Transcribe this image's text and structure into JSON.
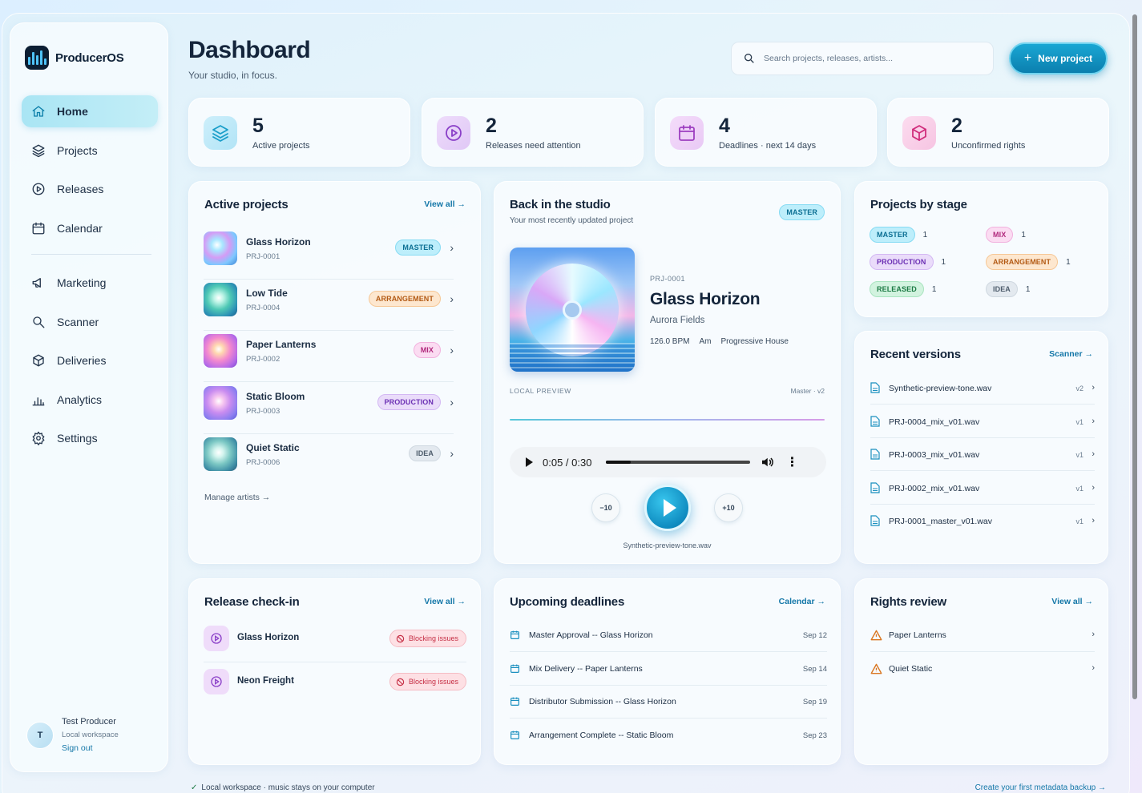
{
  "brand": {
    "name": "ProducerOS"
  },
  "nav": [
    {
      "label": "Home",
      "icon": "home-icon",
      "active": true
    },
    {
      "label": "Projects",
      "icon": "layers-icon"
    },
    {
      "label": "Releases",
      "icon": "play-circle-icon"
    },
    {
      "label": "Calendar",
      "icon": "calendar-icon"
    },
    {
      "label": "Marketing",
      "icon": "megaphone-icon"
    },
    {
      "label": "Scanner",
      "icon": "search-icon"
    },
    {
      "label": "Deliveries",
      "icon": "box-icon"
    },
    {
      "label": "Analytics",
      "icon": "bar-chart-icon"
    },
    {
      "label": "Settings",
      "icon": "gear-icon"
    }
  ],
  "user": {
    "initial": "T",
    "name": "Test Producer",
    "workspace": "Local workspace",
    "sign_out": "Sign out"
  },
  "header": {
    "title": "Dashboard",
    "subtitle": "Your studio, in focus.",
    "search_placeholder": "Search projects, releases, artists...",
    "new_button": "New project"
  },
  "stats": [
    {
      "value": "5",
      "label": "Active projects",
      "icon": "layers-icon",
      "color": "#1a9ec9"
    },
    {
      "value": "2",
      "label": "Releases need attention",
      "icon": "play-circle-icon",
      "color": "#8a3fc8"
    },
    {
      "value": "4",
      "label": "Deadlines · next 14 days",
      "icon": "calendar-icon",
      "color": "#9d3fc0"
    },
    {
      "value": "2",
      "label": "Unconfirmed rights",
      "icon": "cube-icon",
      "color": "#d02d7c"
    }
  ],
  "active_projects": {
    "title": "Active projects",
    "link": "View all →",
    "items": [
      {
        "name": "Glass Horizon",
        "id": "PRJ-0001",
        "stage": "MASTER"
      },
      {
        "name": "Low Tide",
        "id": "PRJ-0004",
        "stage": "ARRANGEMENT"
      },
      {
        "name": "Paper Lanterns",
        "id": "PRJ-0002",
        "stage": "MIX"
      },
      {
        "name": "Static Bloom",
        "id": "PRJ-0003",
        "stage": "PRODUCTION"
      },
      {
        "name": "Quiet Static",
        "id": "PRJ-0006",
        "stage": "IDEA"
      }
    ],
    "manage": "Manage artists →"
  },
  "studio": {
    "title": "Back in the studio",
    "subtitle": "Your most recently updated project",
    "stage": "MASTER",
    "project_id": "PRJ-0001",
    "project_name": "Glass Horizon",
    "artist": "Aurora Fields",
    "bpm": "126.0 BPM",
    "key": "Am",
    "genre": "Progressive House",
    "preview_label": "LOCAL PREVIEW",
    "version_label": "Master · v2",
    "time": "0:05 / 0:30",
    "progress": 0.17,
    "skip_back": "−10",
    "skip_fwd": "+10",
    "file": "Synthetic-preview-tone.wav"
  },
  "stages": {
    "title": "Projects by stage",
    "items": [
      {
        "label": "MASTER",
        "count": "1"
      },
      {
        "label": "MIX",
        "count": "1"
      },
      {
        "label": "PRODUCTION",
        "count": "1"
      },
      {
        "label": "ARRANGEMENT",
        "count": "1"
      },
      {
        "label": "RELEASED",
        "count": "1"
      },
      {
        "label": "IDEA",
        "count": "1"
      }
    ]
  },
  "versions": {
    "title": "Recent versions",
    "link": "Scanner →",
    "items": [
      {
        "file": "Synthetic-preview-tone.wav",
        "version": "v2"
      },
      {
        "file": "PRJ-0004_mix_v01.wav",
        "version": "v1"
      },
      {
        "file": "PRJ-0003_mix_v01.wav",
        "version": "v1"
      },
      {
        "file": "PRJ-0002_mix_v01.wav",
        "version": "v1"
      },
      {
        "file": "PRJ-0001_master_v01.wav",
        "version": "v1"
      }
    ]
  },
  "checkin": {
    "title": "Release check-in",
    "link": "View all →",
    "items": [
      {
        "name": "Glass Horizon",
        "status": "Blocking issues"
      },
      {
        "name": "Neon Freight",
        "status": "Blocking issues"
      }
    ]
  },
  "deadlines": {
    "title": "Upcoming deadlines",
    "link": "Calendar →",
    "items": [
      {
        "name": "Master Approval -- Glass Horizon",
        "date": "Sep 12"
      },
      {
        "name": "Mix Delivery -- Paper Lanterns",
        "date": "Sep 14"
      },
      {
        "name": "Distributor Submission -- Glass Horizon",
        "date": "Sep 19"
      },
      {
        "name": "Arrangement Complete -- Static Bloom",
        "date": "Sep 23"
      }
    ]
  },
  "rights": {
    "title": "Rights review",
    "link": "View all →",
    "items": [
      {
        "name": "Paper Lanterns"
      },
      {
        "name": "Quiet Static"
      }
    ]
  },
  "footer": {
    "left": "Local workspace · music stays on your computer",
    "right": "Create your first metadata backup →"
  }
}
